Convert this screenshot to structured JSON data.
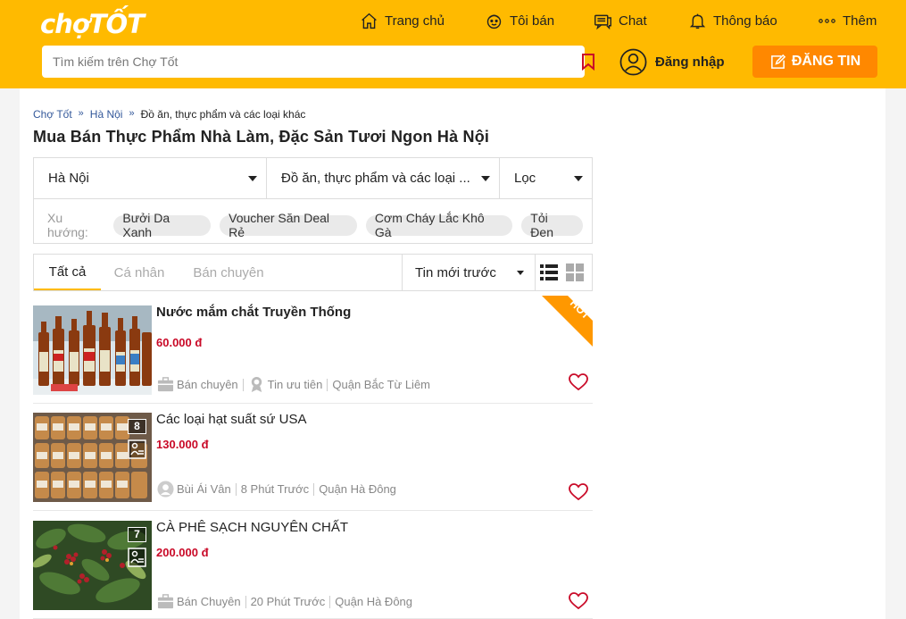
{
  "header": {
    "logo": "chợTỐT",
    "nav": [
      {
        "label": "Trang chủ",
        "icon": "home-icon"
      },
      {
        "label": "Tôi bán",
        "icon": "seller-face-icon"
      },
      {
        "label": "Chat",
        "icon": "chat-icon"
      },
      {
        "label": "Thông báo",
        "icon": "bell-icon"
      },
      {
        "label": "Thêm",
        "icon": "more-dots-icon"
      }
    ],
    "search_placeholder": "Tìm kiếm trên Chợ Tốt",
    "login_label": "Đăng nhập",
    "post_label": "ĐĂNG TIN"
  },
  "breadcrumb": [
    {
      "label": "Chợ Tốt",
      "sep": "»"
    },
    {
      "label": "Hà Nội",
      "sep": "»"
    },
    {
      "label": "Đồ ăn, thực phẩm và các loại khác"
    }
  ],
  "page_title": "Mua Bán Thực Phẩm Nhà Làm, Đặc Sản Tươi Ngon Hà Nội",
  "filters": {
    "region": "Hà Nội",
    "category": "Đồ ăn, thực phẩm và các loại ...",
    "filter": "Lọc",
    "trend_label": "Xu hướng:",
    "trends": [
      "Bưởi Da Xanh",
      "Voucher Săn Deal Rẻ",
      "Cơm Cháy Lắc Khô Gà",
      "Tỏi Đen"
    ]
  },
  "tabs": {
    "items": [
      "Tất cả",
      "Cá nhân",
      "Bán chuyên"
    ],
    "active_index": 0,
    "sort": "Tin mới trước"
  },
  "listings": [
    {
      "title": "Nước mắm chắt Truyền Thống",
      "price": "60.000 đ",
      "meta": [
        "Bán chuyên",
        "Tin ưu tiên",
        "Quận Bắc Từ Liêm"
      ],
      "badge": "HOT"
    },
    {
      "title": "Các loại hạt suất sứ USA",
      "price": "130.000 đ",
      "image_count": "8",
      "meta": [
        "Bùi Ái Vân",
        "8 Phút Trước",
        "Quận Hà Đông"
      ]
    },
    {
      "title": "CÀ PHÊ SẠCH NGUYÊN CHẤT",
      "price": "200.000 đ",
      "image_count": "7",
      "meta": [
        "Bán Chuyên",
        "20 Phút Trước",
        "Quận Hà Đông"
      ]
    }
  ],
  "colors": {
    "header_bg": "#ffba00",
    "post_button": "#ff8800",
    "price": "#c90927",
    "hot_badge": "#ff9800",
    "link": "#33589a"
  }
}
